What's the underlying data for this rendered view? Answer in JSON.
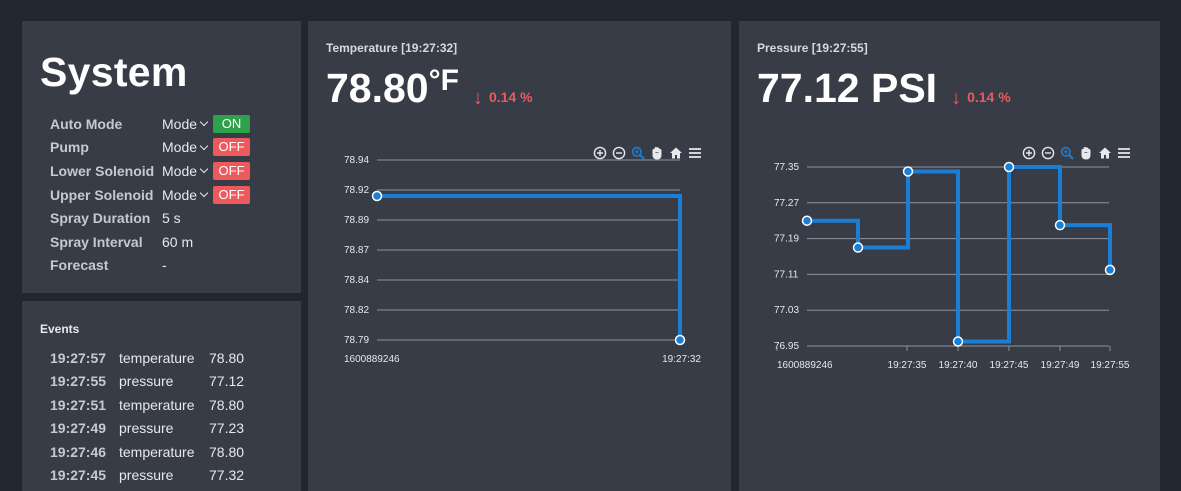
{
  "system": {
    "title": "System",
    "rows": [
      {
        "label": "Auto Mode",
        "mode": "Mode",
        "state": "ON"
      },
      {
        "label": "Pump",
        "mode": "Mode",
        "state": "OFF"
      },
      {
        "label": "Lower Solenoid",
        "mode": "Mode",
        "state": "OFF"
      },
      {
        "label": "Upper Solenoid",
        "mode": "Mode",
        "state": "OFF"
      },
      {
        "label": "Spray Duration",
        "value": "5 s"
      },
      {
        "label": "Spray Interval",
        "value": "60 m"
      },
      {
        "label": "Forecast",
        "value": "-"
      }
    ]
  },
  "events": {
    "title": "Events",
    "items": [
      {
        "time": "19:27:57",
        "name": "temperature",
        "value": "78.80"
      },
      {
        "time": "19:27:55",
        "name": "pressure",
        "value": "77.12"
      },
      {
        "time": "19:27:51",
        "name": "temperature",
        "value": "78.80"
      },
      {
        "time": "19:27:49",
        "name": "pressure",
        "value": "77.23"
      },
      {
        "time": "19:27:46",
        "name": "temperature",
        "value": "78.80"
      },
      {
        "time": "19:27:45",
        "name": "pressure",
        "value": "77.32"
      }
    ]
  },
  "temperature": {
    "caption": "Temperature [19:27:32]",
    "value": "78.80",
    "unit": "°F",
    "change": "0.14 %"
  },
  "pressure": {
    "caption": "Pressure [19:27:55]",
    "value": "77.12 PSI",
    "change": "0.14 %"
  },
  "toolbar_icons": [
    "zoom-in-icon",
    "zoom-out-icon",
    "zoom-select-icon",
    "pan-hand-icon",
    "home-icon",
    "menu-icon"
  ],
  "colors": {
    "line": "#1a7fd4",
    "on": "#2ea24a",
    "off": "#ec5a5e",
    "toolbar_active": "#1a7fd4",
    "panel": "#383c47",
    "background": "#22262e"
  },
  "chart_data": [
    {
      "type": "line",
      "step": true,
      "yticks": [
        "78.94",
        "78.92",
        "78.89",
        "78.87",
        "78.84",
        "78.82",
        "78.79"
      ],
      "xticks": [
        "1600889246",
        "19:27:32"
      ],
      "ylim": [
        78.79,
        78.94
      ],
      "x": [
        "1600889246",
        "19:27:32"
      ],
      "values": [
        78.91,
        78.79
      ],
      "grid": true
    },
    {
      "type": "line",
      "step": true,
      "yticks": [
        "77.35",
        "77.27",
        "77.19",
        "77.11",
        "77.03",
        "76.95"
      ],
      "xticks": [
        "1600889246",
        "19:27:35",
        "19:27:40",
        "19:27:45",
        "19:27:49",
        "19:27:55"
      ],
      "ylim": [
        76.95,
        77.35
      ],
      "values": [
        77.23,
        77.17,
        77.34,
        76.96,
        77.35,
        77.22,
        77.12
      ],
      "grid": true
    }
  ]
}
